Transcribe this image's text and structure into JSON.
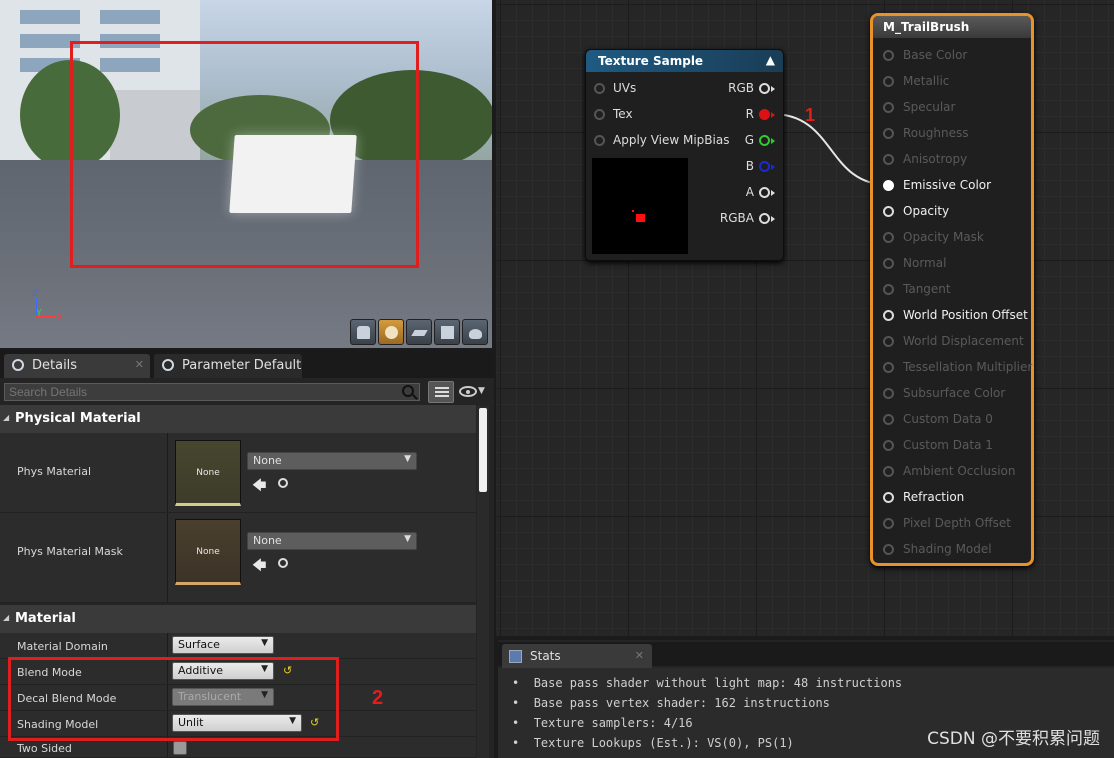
{
  "viewport": {
    "axes": {
      "z": "Z",
      "y": "Y",
      "x": "X"
    },
    "toolbar": [
      "cylinder-icon",
      "sphere-icon",
      "plane-icon",
      "cube-icon",
      "teapot-icon"
    ],
    "active_tool": "sphere-icon"
  },
  "annotations": {
    "label_1": "1",
    "label_2": "2"
  },
  "details": {
    "tabs": [
      {
        "label": "Details"
      },
      {
        "label": "Parameter Defaults"
      }
    ],
    "search_placeholder": "Search Details",
    "physical_material": {
      "title": "Physical Material",
      "phys_material": {
        "label": "Phys Material",
        "thumb": "None",
        "value": "None"
      },
      "phys_material_mask": {
        "label": "Phys Material Mask",
        "thumb": "None",
        "value": "None"
      }
    },
    "material": {
      "title": "Material",
      "domain": {
        "label": "Material Domain",
        "value": "Surface"
      },
      "blend_mode": {
        "label": "Blend Mode",
        "value": "Additive"
      },
      "decal_blend_mode": {
        "label": "Decal Blend Mode",
        "value": "Translucent"
      },
      "shading_model": {
        "label": "Shading Model",
        "value": "Unlit"
      },
      "two_sided": {
        "label": "Two Sided"
      }
    }
  },
  "graph": {
    "texture_node": {
      "title": "Texture Sample",
      "header_color": "#1e5a82",
      "inputs": [
        "UVs",
        "Tex",
        "Apply View MipBias"
      ],
      "outputs": [
        "RGB",
        "R",
        "G",
        "B",
        "A",
        "RGBA"
      ]
    },
    "material_node": {
      "title": "M_TrailBrush",
      "border_color": "#e8932a",
      "pins": [
        {
          "label": "Base Color",
          "active": false
        },
        {
          "label": "Metallic",
          "active": false
        },
        {
          "label": "Specular",
          "active": false
        },
        {
          "label": "Roughness",
          "active": false
        },
        {
          "label": "Anisotropy",
          "active": false
        },
        {
          "label": "Emissive Color",
          "active": true,
          "connected": true
        },
        {
          "label": "Opacity",
          "active": true
        },
        {
          "label": "Opacity Mask",
          "active": false
        },
        {
          "label": "Normal",
          "active": false
        },
        {
          "label": "Tangent",
          "active": false
        },
        {
          "label": "World Position Offset",
          "active": true
        },
        {
          "label": "World Displacement",
          "active": false
        },
        {
          "label": "Tessellation Multiplier",
          "active": false
        },
        {
          "label": "Subsurface Color",
          "active": false
        },
        {
          "label": "Custom Data 0",
          "active": false
        },
        {
          "label": "Custom Data 1",
          "active": false
        },
        {
          "label": "Ambient Occlusion",
          "active": false
        },
        {
          "label": "Refraction",
          "active": true
        },
        {
          "label": "Pixel Depth Offset",
          "active": false
        },
        {
          "label": "Shading Model",
          "active": false
        }
      ]
    }
  },
  "stats": {
    "tab": "Stats",
    "lines": [
      "Base pass shader without light map: 48 instructions",
      "Base pass vertex shader: 162 instructions",
      "Texture samplers: 4/16",
      "Texture Lookups (Est.): VS(0), PS(1)"
    ],
    "watermark": "CSDN @不要积累问题"
  }
}
